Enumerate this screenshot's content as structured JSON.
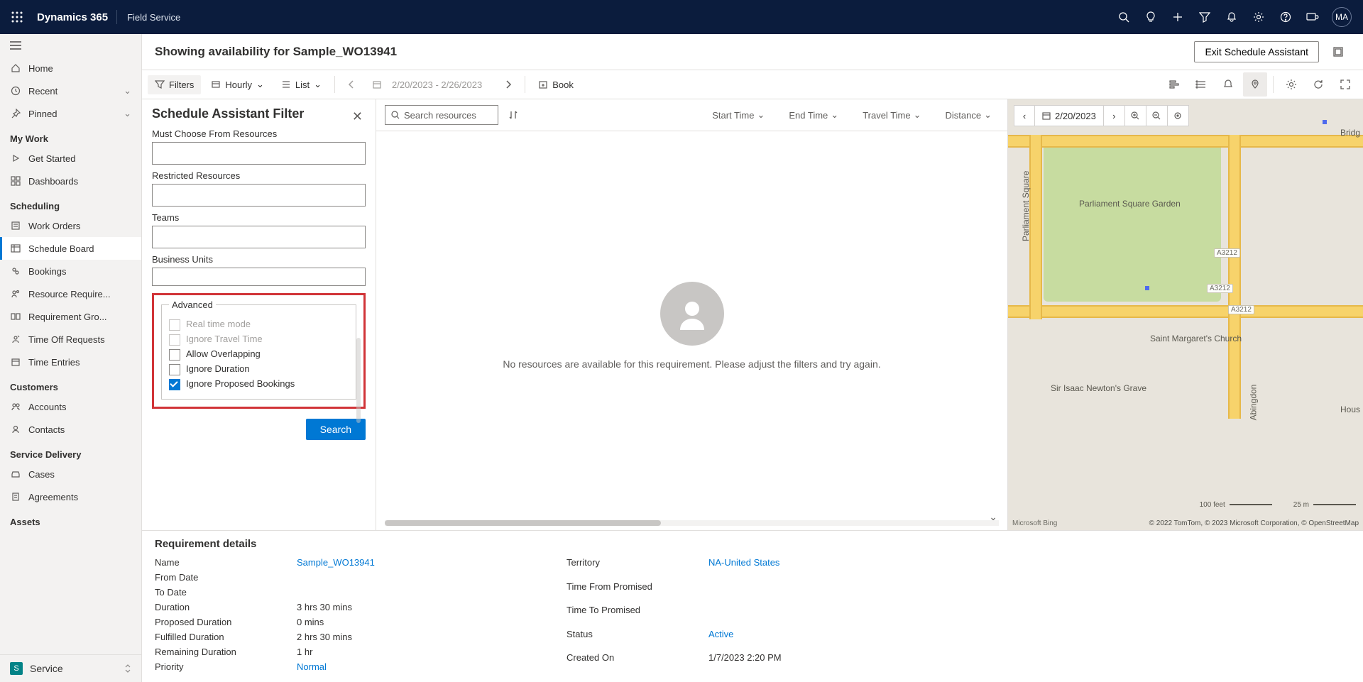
{
  "topnav": {
    "brand": "Dynamics 365",
    "module": "Field Service",
    "avatar": "MA"
  },
  "leftnav": {
    "home": "Home",
    "recent": "Recent",
    "pinned": "Pinned",
    "groups": {
      "mywork": "My Work",
      "scheduling": "Scheduling",
      "customers": "Customers",
      "servicedelivery": "Service Delivery",
      "assets": "Assets"
    },
    "items": {
      "getstarted": "Get Started",
      "dashboards": "Dashboards",
      "workorders": "Work Orders",
      "scheduleboard": "Schedule Board",
      "bookings": "Bookings",
      "resourcereq": "Resource Require...",
      "reqgroups": "Requirement Gro...",
      "timeoff": "Time Off Requests",
      "timeentries": "Time Entries",
      "accounts": "Accounts",
      "contacts": "Contacts",
      "cases": "Cases",
      "agreements": "Agreements"
    },
    "appswitch": {
      "badge": "S",
      "label": "Service"
    }
  },
  "page": {
    "title": "Showing availability for Sample_WO13941",
    "exit": "Exit Schedule Assistant"
  },
  "toolbar": {
    "filters": "Filters",
    "hourly": "Hourly",
    "list": "List",
    "daterange": "2/20/2023 - 2/26/2023",
    "book": "Book"
  },
  "filter": {
    "title": "Schedule Assistant Filter",
    "must": "Must Choose From Resources",
    "restricted": "Restricted Resources",
    "teams": "Teams",
    "bu": "Business Units",
    "advanced": "Advanced",
    "realtime": "Real time mode",
    "ignoretravel": "Ignore Travel Time",
    "allowoverlap": "Allow Overlapping",
    "ignoredur": "Ignore Duration",
    "ignoreprop": "Ignore Proposed Bookings",
    "search": "Search"
  },
  "results": {
    "searchPlaceholder": "Search resources",
    "cols": {
      "start": "Start Time",
      "end": "End Time",
      "travel": "Travel Time",
      "distance": "Distance"
    },
    "msg": "No resources are available for this requirement. Please adjust the filters and try again."
  },
  "map": {
    "date": "2/20/2023",
    "labels": {
      "parliamentsq": "Parliament Square",
      "garden": "Parliament Square Garden",
      "stmargaret": "Saint Margaret's Church",
      "newton": "Sir Isaac Newton's Grave",
      "bridg": "Bridg",
      "abingdon": "Abingdon",
      "hous": "Hous"
    },
    "badges": {
      "a3212": "A3212"
    },
    "scale": {
      "feet": "100 feet",
      "m": "25 m"
    },
    "bing": "Microsoft Bing",
    "attr": "© 2022 TomTom, © 2023 Microsoft Corporation, © OpenStreetMap"
  },
  "req": {
    "title": "Requirement details",
    "left": {
      "name_l": "Name",
      "name_v": "Sample_WO13941",
      "from_l": "From Date",
      "from_v": "",
      "to_l": "To Date",
      "to_v": "",
      "dur_l": "Duration",
      "dur_v": "3 hrs 30 mins",
      "prop_l": "Proposed Duration",
      "prop_v": "0 mins",
      "ful_l": "Fulfilled Duration",
      "ful_v": "2 hrs 30 mins",
      "rem_l": "Remaining Duration",
      "rem_v": "1 hr",
      "pri_l": "Priority",
      "pri_v": "Normal"
    },
    "right": {
      "terr_l": "Territory",
      "terr_v": "NA-United States",
      "tfp_l": "Time From Promised",
      "tfp_v": "",
      "ttp_l": "Time To Promised",
      "ttp_v": "",
      "status_l": "Status",
      "status_v": "Active",
      "cre_l": "Created On",
      "cre_v": "1/7/2023 2:20 PM"
    }
  }
}
